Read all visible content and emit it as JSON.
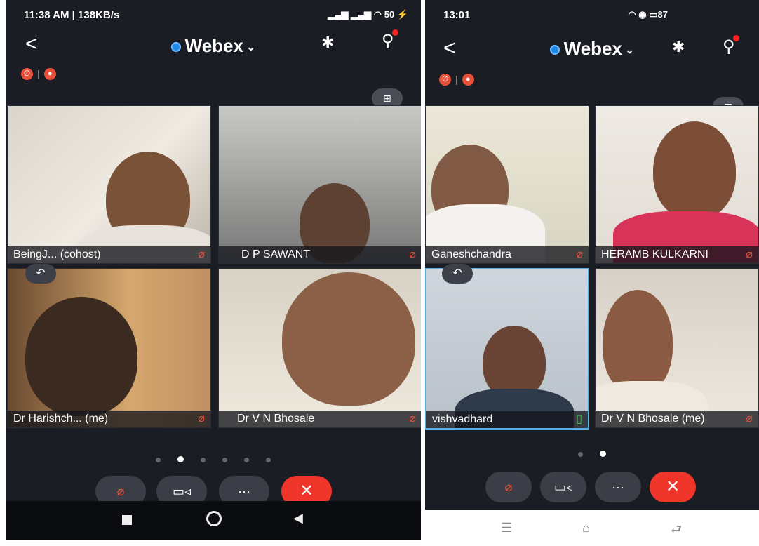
{
  "colors": {
    "bg": "#1b1d24",
    "accent": "#1e88e5",
    "mute": "#e8503a",
    "end": "#f0352a",
    "speaking": "#5ab0e6"
  },
  "left_phone": {
    "status": {
      "time": "11:38 AM | 138KB/s",
      "right": "50"
    },
    "app_title": "Webex",
    "tiles": [
      {
        "name": "BeingJ... (cohost)",
        "mic": "muted"
      },
      {
        "name": "D P SAWANT",
        "mic": "muted"
      },
      {
        "name": "Dr Harishch... (me)",
        "mic": "muted"
      },
      {
        "name": "Dr V N Bhosale",
        "mic": "muted"
      }
    ],
    "page_dots": {
      "count": 6,
      "active": 2
    }
  },
  "right_phone": {
    "status": {
      "time": "13:01",
      "right": "87"
    },
    "app_title": "Webex",
    "tiles": [
      {
        "name": "Ganeshchandra",
        "mic": "muted"
      },
      {
        "name": "HERAMB KULKARNI",
        "mic": "muted"
      },
      {
        "name": "vishvadhard",
        "mic": "on"
      },
      {
        "name": "Dr V N Bhosale (me)",
        "mic": "muted"
      }
    ],
    "page_dots": {
      "count": 2,
      "active": 2
    }
  },
  "icons": [
    "back-icon",
    "bluetooth-icon",
    "participants-icon",
    "layout-icon",
    "reply-icon",
    "mute-icon",
    "video-icon",
    "more-icon",
    "end-call-icon"
  ],
  "controls": {
    "more": "···"
  }
}
